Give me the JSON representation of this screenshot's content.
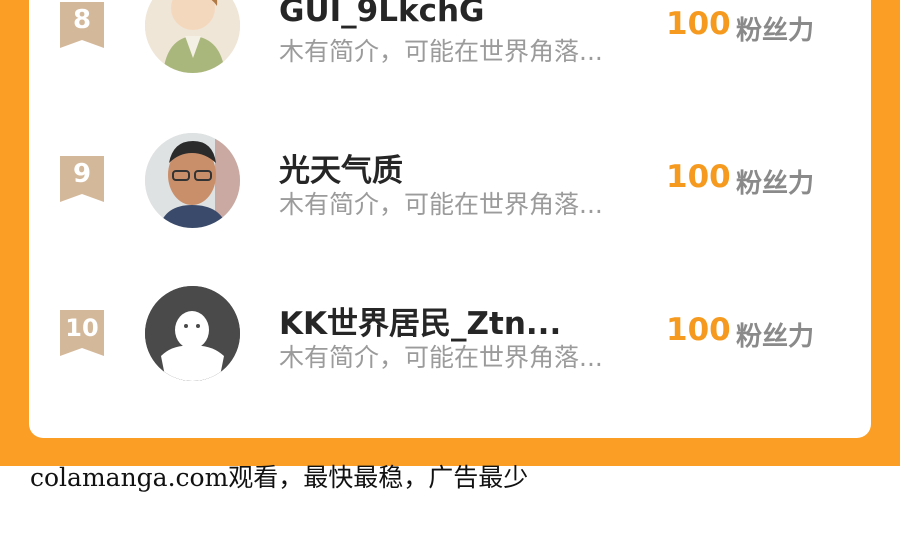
{
  "leaderboard": {
    "rows": [
      {
        "rank": "8",
        "name": "GUI_9LkchG",
        "bio": "木有简介，可能在世界角落...",
        "score": "100",
        "unit": "粉丝力"
      },
      {
        "rank": "9",
        "name": "光天气质",
        "bio": "木有简介，可能在世界角落...",
        "score": "100",
        "unit": "粉丝力"
      },
      {
        "rank": "10",
        "name": "KK世界居民_Ztn...",
        "bio": "木有简介，可能在世界角落...",
        "score": "100",
        "unit": "粉丝力"
      }
    ]
  },
  "footer": {
    "watermark": "colamanga.com观看，最快最稳，广告最少"
  },
  "colors": {
    "accent": "#fa9e25",
    "score": "#f59a1e",
    "rank_badge": "#d4b89a"
  },
  "icons": {
    "rank_badge": "ribbon-badge-icon",
    "default_avatar": "default-avatar-icon"
  }
}
